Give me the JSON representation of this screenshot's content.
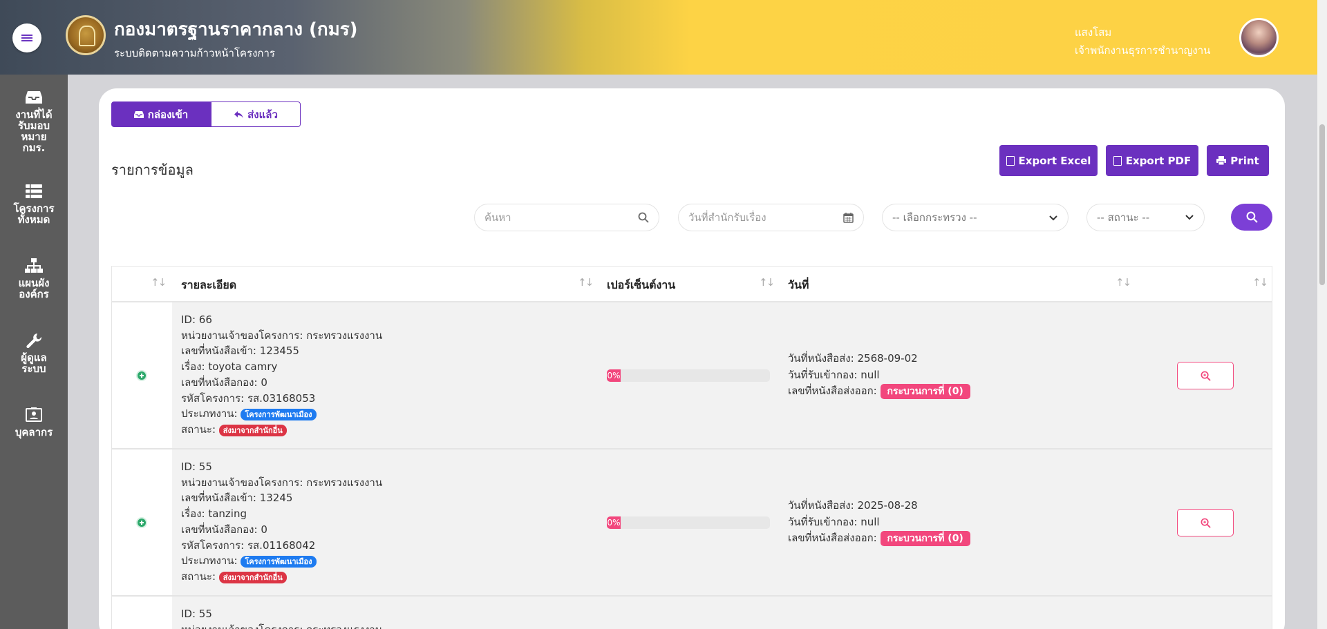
{
  "header": {
    "org_title": "กองมาตรฐานราคากลาง (กมร)",
    "org_subtitle": "ระบบติดตามความก้าวหน้าโครงการ",
    "user_name": "แสงโสม",
    "user_role": "เจ้าพนักงานธุรการชำนาญงาน"
  },
  "sidebar": {
    "items": [
      {
        "label": "งานที่ได้รับมอบหมาย กมร.",
        "icon": "inbox-icon"
      },
      {
        "label": "โครงการทั้งหมด",
        "icon": "list-icon"
      },
      {
        "label": "แผนผังองค์กร",
        "icon": "sitemap-icon"
      },
      {
        "label": "ผู้ดูแลระบบ",
        "icon": "wrench-icon"
      },
      {
        "label": "บุคลากร",
        "icon": "id-card-icon"
      }
    ]
  },
  "tabs": [
    {
      "label": "กล่องเข้า",
      "icon": "inbox-icon",
      "active": true
    },
    {
      "label": "ส่งแล้ว",
      "icon": "reply-icon",
      "active": false
    }
  ],
  "section_title": "รายการข้อมูล",
  "actions": {
    "export_excel": "Export Excel",
    "export_pdf": "Export PDF",
    "print": "Print"
  },
  "filters": {
    "search_placeholder": "ค้นหา",
    "date_placeholder": "วันที่สำนักรับเรื่อง",
    "ministry_select": "-- เลือกกระทรวง --",
    "status_select": "-- สถานะ --"
  },
  "table": {
    "headers": {
      "detail": "รายละเอียด",
      "percent": "เปอร์เซ็นต์งาน",
      "date": "วันที่"
    },
    "labels": {
      "id": "ID: ",
      "owner": "หน่วยงานเจ้าของโครงการ: ",
      "inbound_no": "เลขที่หนังสือเข้า: ",
      "subject": "เรื่อง: ",
      "division_no": "เลขที่หนังสือกอง: ",
      "project_code": "รหัสโครงการ: ",
      "type": "ประเภทงาน: ",
      "status": "สถานะ: ",
      "send_date": "วันที่หนังสือส่ง: ",
      "received_date": "วันที่รับเข้ากอง: ",
      "outbound_no": "เลขที่หนังสือส่งออก: "
    },
    "rows": [
      {
        "id": "66",
        "owner": "กระทรวงแรงงาน",
        "inbound_no": "123455",
        "subject": "toyota camry",
        "division_no": "0",
        "project_code": "รส.03168053",
        "type_badge": "โครงการพัฒนาเมือง",
        "status_badge": "ส่งมาจากสำนักอื่น",
        "percent": "0%",
        "send_date": "2568-09-02",
        "received_date": "null",
        "outbound_badge": "กระบวนการที่ (0)"
      },
      {
        "id": "55",
        "owner": "กระทรวงแรงงาน",
        "inbound_no": "13245",
        "subject": "tanzing",
        "division_no": "0",
        "project_code": "รส.01168042",
        "type_badge": "โครงการพัฒนาเมือง",
        "status_badge": "ส่งมาจากสำนักอื่น",
        "percent": "0%",
        "send_date": "2025-08-28",
        "received_date": "null",
        "outbound_badge": "กระบวนการที่ (0)"
      },
      {
        "id": "55",
        "owner": "กระทรวงแรงงาน"
      }
    ]
  },
  "colors": {
    "primary": "#6b30bf",
    "pink": "#f2477d",
    "blue_badge": "#1e7bf0",
    "red_badge": "#dc3545",
    "sidebar": "#5c5c5c",
    "header_yellow": "#fdd345"
  }
}
